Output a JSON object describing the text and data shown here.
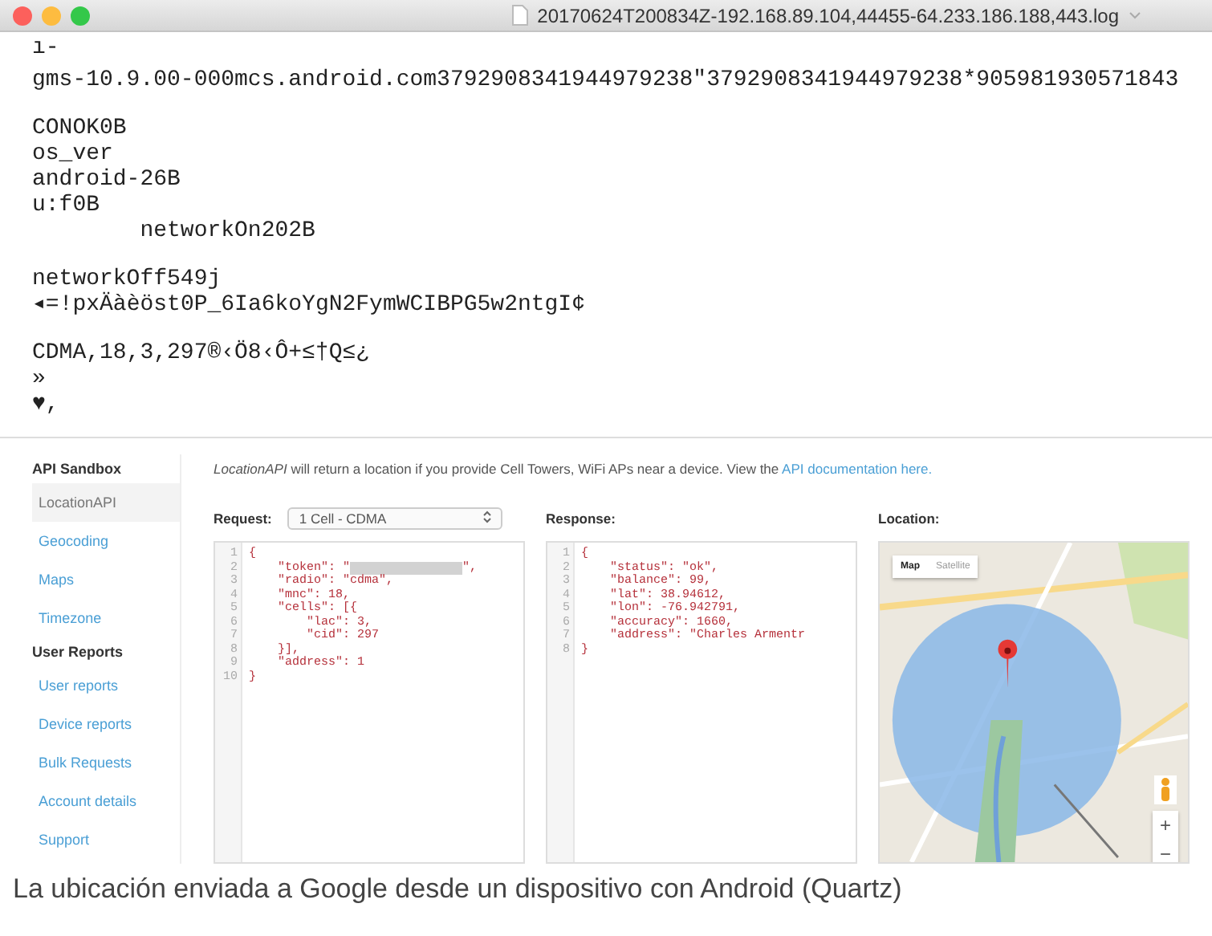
{
  "log_window": {
    "title": "20170624T200834Z-192.168.89.104,44455-64.233.186.188,443.log",
    "blocks": [
      [
        "ı-"
      ],
      [
        "gms-10.9.00-000mcs.android.com3792908341944979238\"3792908341944979238*905981930571843"
      ],
      [
        "CONOK0B",
        "os_ver",
        "android-26B",
        "u:f0B",
        "        networkOn202B"
      ],
      [
        "networkOff549j",
        "◂=!pxÄàèöst0P_6Ia6koYgN2FymWCIBPG5w2ntgI¢"
      ],
      [
        "CDMA,18,3,297®‹Ö8‹Ô+≤†Q≤¿",
        "»",
        "♥,"
      ]
    ]
  },
  "sandbox": {
    "sidebar": [
      {
        "kind": "heading",
        "label": "API Sandbox"
      },
      {
        "kind": "link",
        "label": "LocationAPI",
        "selected": true
      },
      {
        "kind": "link",
        "label": "Geocoding",
        "selected": false
      },
      {
        "kind": "link",
        "label": "Maps",
        "selected": false
      },
      {
        "kind": "link",
        "label": "Timezone",
        "selected": false
      },
      {
        "kind": "heading",
        "label": "User Reports"
      },
      {
        "kind": "link",
        "label": "User reports",
        "selected": false
      },
      {
        "kind": "link",
        "label": "Device reports",
        "selected": false
      },
      {
        "kind": "link",
        "label": "Bulk Requests",
        "selected": false
      },
      {
        "kind": "link",
        "label": "Account details",
        "selected": false
      },
      {
        "kind": "link",
        "label": "Support",
        "selected": false
      }
    ],
    "intro": "*LocationAPI* will return a location if you provide Cell Towers, WiFi APs near a device. View the",
    "intro_link": "API documentation here.",
    "request": {
      "label": "Request:",
      "select": "1 Cell - CDMA",
      "lines": [
        {
          "n": "1",
          "text": "{"
        },
        {
          "n": "2",
          "text": "    \"token\": \"",
          "redacted": true,
          "tail": "\","
        },
        {
          "n": "3",
          "text": "    \"radio\": \"cdma\","
        },
        {
          "n": "4",
          "text": "    \"mnc\": 18,"
        },
        {
          "n": "5",
          "text": "    \"cells\": [{"
        },
        {
          "n": "6",
          "text": "        \"lac\": 3,"
        },
        {
          "n": "7",
          "text": "        \"cid\": 297"
        },
        {
          "n": "8",
          "text": "    }],"
        },
        {
          "n": "9",
          "text": "    \"address\": 1"
        },
        {
          "n": "10",
          "text": "}"
        }
      ]
    },
    "response": {
      "label": "Response:",
      "lines": [
        {
          "n": "1",
          "text": "{"
        },
        {
          "n": "2",
          "text": "    \"status\": \"ok\","
        },
        {
          "n": "3",
          "text": "    \"balance\": 99,"
        },
        {
          "n": "4",
          "text": "    \"lat\": 38.94612,"
        },
        {
          "n": "5",
          "text": "    \"lon\": -76.942791,"
        },
        {
          "n": "6",
          "text": "    \"accuracy\": 1660,"
        },
        {
          "n": "7",
          "text": "    \"address\": \"Charles Armentr"
        },
        {
          "n": "8",
          "text": "}"
        }
      ]
    },
    "location": {
      "label": "Location:",
      "map_types": [
        {
          "label": "Map",
          "selected": true
        },
        {
          "label": "Satellite",
          "selected": false
        }
      ],
      "zoom_in": "+",
      "zoom_out": "−"
    }
  },
  "caption": "La ubicación enviada a Google desde un dispositivo con Android (Quartz)"
}
